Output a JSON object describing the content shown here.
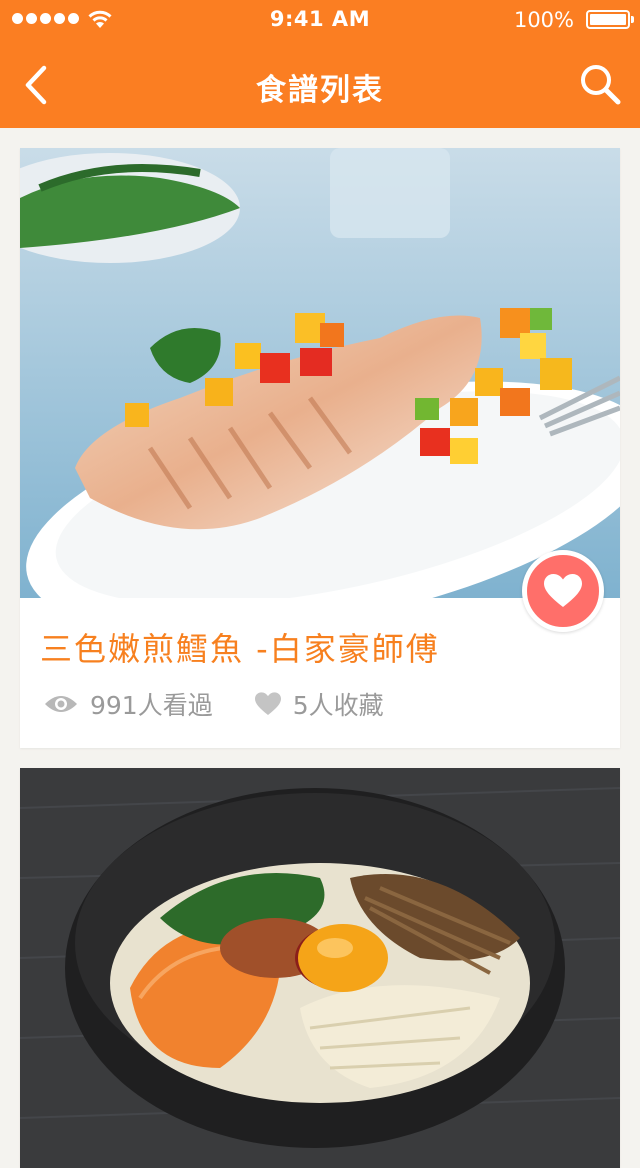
{
  "status": {
    "time": "9:41 AM",
    "battery": "100%"
  },
  "nav": {
    "title": "食譜列表"
  },
  "recipes": [
    {
      "title": "三色嫩煎鱈魚 -白家豪師傅",
      "views": "991人看過",
      "favorites": "5人收藏",
      "favorited": true
    },
    {
      "title": "",
      "views": "",
      "favorites": ""
    }
  ],
  "colors": {
    "header": "#fb7e22",
    "title_text": "#f7801f",
    "fav_button": "#ff6f6a",
    "background": "#f4f3ef"
  },
  "icons": {
    "back": "chevron-left-icon",
    "search": "search-icon",
    "favorite": "heart-icon",
    "views": "eye-icon",
    "favorites": "heart-icon",
    "wifi": "wifi-icon",
    "battery": "battery-icon"
  }
}
